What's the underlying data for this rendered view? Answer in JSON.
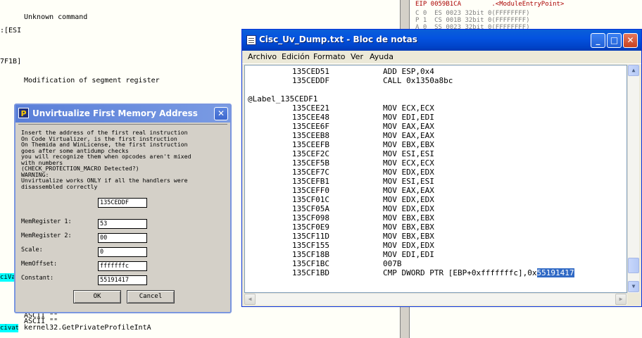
{
  "background": {
    "left_lines": [
      {
        "text": "Unknown command"
      },
      {
        "text": ":[ESI"
      },
      {
        "text": "7F1B]"
      },
      {
        "text": "Modification of segment register"
      },
      {
        "text": "ASCII \"\""
      },
      {
        "text": "ASCII \"\""
      },
      {
        "text": "kernel32.GetPrivateProfileIntA"
      }
    ],
    "cyan_marks": [
      "ciVa",
      "civat"
    ],
    "registers": [
      "EIP 0059B1CA        .<ModuleEntryPoint>",
      "C 0  ES 0023 32bit 0(FFFFFFFF)",
      "P 1  CS 001B 32bit 0(FFFFFFFF)",
      "A 0  SS 0023 32bit 0(FFFFFFFF)"
    ]
  },
  "notepad": {
    "title": "Cisc_Uv_Dump.txt - Bloc de notas",
    "controls": {
      "minimize": "_",
      "maximize": "□",
      "close": "✕"
    },
    "menu": [
      "Archivo",
      "Edición",
      "Formato",
      "Ver",
      "Ayuda"
    ],
    "lines": [
      {
        "addr": "135CED51",
        "instr": "ADD ESP,0x4"
      },
      {
        "addr": "135CEDDF",
        "instr": "CALL 0x1350a8bc"
      },
      {
        "addr": "",
        "instr": ""
      },
      {
        "label": "@Label_135CEDF1"
      },
      {
        "addr": "135CEE21",
        "instr": "MOV ECX,ECX"
      },
      {
        "addr": "135CEE48",
        "instr": "MOV EDI,EDI"
      },
      {
        "addr": "135CEE6F",
        "instr": "MOV EAX,EAX"
      },
      {
        "addr": "135CEEB8",
        "instr": "MOV EAX,EAX"
      },
      {
        "addr": "135CEEFB",
        "instr": "MOV EBX,EBX"
      },
      {
        "addr": "135CEF2C",
        "instr": "MOV ESI,ESI"
      },
      {
        "addr": "135CEF5B",
        "instr": "MOV ECX,ECX"
      },
      {
        "addr": "135CEF7C",
        "instr": "MOV EDX,EDX"
      },
      {
        "addr": "135CEFB1",
        "instr": "MOV ESI,ESI"
      },
      {
        "addr": "135CEFF0",
        "instr": "MOV EAX,EAX"
      },
      {
        "addr": "135CF01C",
        "instr": "MOV EDX,EDX"
      },
      {
        "addr": "135CF05A",
        "instr": "MOV EDX,EDX"
      },
      {
        "addr": "135CF098",
        "instr": "MOV EBX,EBX"
      },
      {
        "addr": "135CF0E9",
        "instr": "MOV EBX,EBX"
      },
      {
        "addr": "135CF11D",
        "instr": "MOV EBX,EBX"
      },
      {
        "addr": "135CF155",
        "instr": "MOV EDX,EDX"
      },
      {
        "addr": "135CF18B",
        "instr": "MOV EDI,EDI"
      },
      {
        "addr": "135CF1BC",
        "instr": "007B"
      },
      {
        "addr": "135CF1BD",
        "instr": "CMP DWORD PTR [EBP+0xfffffffc],0x",
        "selected": "55191417"
      }
    ]
  },
  "dialog": {
    "title": "Unvirtualize First Memory Address",
    "icon_letter": "P",
    "instructions": "Insert the address of the first real instruction\nOn Code Virtualizer, is the first instruction\nOn Themida and WinLicense, the first instruction\ngoes after some antidump checks\nyou will recognize them when opcodes aren't mixed\nwith numbers\n(CHECK_PROTECTION_MACRO Detected?)\nWARNING:\nUnvirtualize works ONLY if all the handlers were\ndisassembled correctly",
    "address_value": "135CEDDF",
    "fields": [
      {
        "label": "MemRegister 1:",
        "value": "53"
      },
      {
        "label": "MemRegister 2:",
        "value": "00"
      },
      {
        "label": "Scale:",
        "value": "0"
      },
      {
        "label": "MemOffset:",
        "value": "fffffffc"
      },
      {
        "label": "Constant:",
        "value": "55191417"
      }
    ],
    "ok_label": "OK",
    "cancel_label": "Cancel"
  }
}
